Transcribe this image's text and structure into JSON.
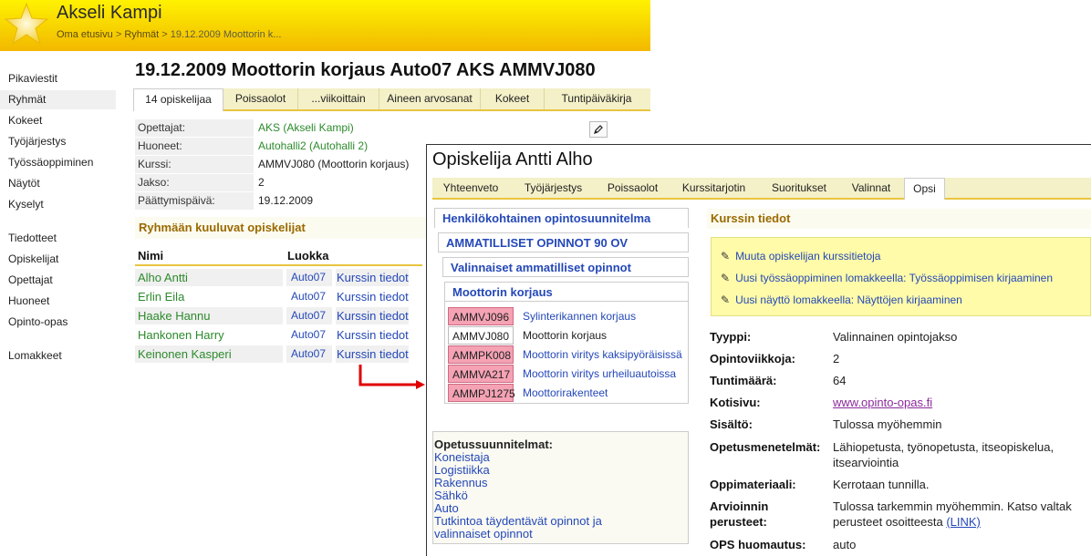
{
  "header": {
    "user_name": "Akseli Kampi",
    "breadcrumb": [
      "Oma etusivu",
      "Ryhmät",
      "19.12.2009 Moottorin k..."
    ],
    "separator": ">"
  },
  "sidebar": {
    "items": [
      {
        "label": "Pikaviestit"
      },
      {
        "label": "Ryhmät",
        "active": true
      },
      {
        "label": "Kokeet"
      },
      {
        "label": "Työjärjestys"
      },
      {
        "label": "Työssäoppiminen"
      },
      {
        "label": "Näytöt"
      },
      {
        "label": "Kyselyt"
      },
      {
        "label": "Tiedotteet"
      },
      {
        "label": "Opiskelijat"
      },
      {
        "label": "Opettajat"
      },
      {
        "label": "Huoneet"
      },
      {
        "label": "Opinto-opas"
      },
      {
        "label": "Lomakkeet"
      }
    ]
  },
  "main": {
    "title": "19.12.2009 Moottorin korjaus Auto07 AKS AMMVJ080",
    "tabs": [
      "14 opiskelijaa",
      "Poissaolot",
      "...viikoittain",
      "Aineen arvosanat",
      "Kokeet",
      "Tuntipäiväkirja"
    ],
    "info": [
      {
        "label": "Opettajat:",
        "value": "AKS (Akseli Kampi)",
        "link": true
      },
      {
        "label": "Huoneet:",
        "value": "Autohalli2 (Autohalli 2)",
        "link": true
      },
      {
        "label": "Kurssi:",
        "value": "AMMVJ080 (Moottorin korjaus)",
        "link": false
      },
      {
        "label": "Jakso:",
        "value": "2",
        "link": false
      },
      {
        "label": "Päättymispäivä:",
        "value": "19.12.2009",
        "link": false
      }
    ],
    "edit_icon": "pencil-icon",
    "students_heading": "Ryhmään kuuluvat opiskelijat",
    "students_columns": [
      "Nimi",
      "Luokka"
    ],
    "students": [
      {
        "name": "Alho Antti",
        "class": "Auto07",
        "link": "Kurssin tiedot"
      },
      {
        "name": "Erlin Eila",
        "class": "Auto07",
        "link": "Kurssin tiedot"
      },
      {
        "name": "Haake Hannu",
        "class": "Auto07",
        "link": "Kurssin tiedot"
      },
      {
        "name": "Hankonen Harry",
        "class": "Auto07",
        "link": "Kurssin tiedot"
      },
      {
        "name": "Keinonen Kasperi",
        "class": "Auto07",
        "link": "Kurssin tiedot"
      }
    ]
  },
  "popup": {
    "title": "Opiskelija Antti Alho",
    "tabs": [
      "Yhteenveto",
      "Työjärjestys",
      "Poissaolot",
      "Kurssitarjotin",
      "Suoritukset",
      "Valinnat",
      "Opsi"
    ],
    "active_tab": "Opsi",
    "plan": {
      "heading": "Henkilökohtainen opintosuunnitelma",
      "section": "AMMATILLISET OPINNOT 90 OV",
      "subsection": "Valinnaiset ammatilliset opinnot",
      "group": "Moottorin korjaus",
      "courses": [
        {
          "code": "AMMVJ096",
          "name": "Sylinterikannen korjaus",
          "highlight": true
        },
        {
          "code": "AMMVJ080",
          "name": "Moottorin korjaus",
          "highlight": false
        },
        {
          "code": "AMMPK008",
          "name": "Moottorin viritys kaksipyöräisissä",
          "highlight": true
        },
        {
          "code": "AMMVA217",
          "name": "Moottorin viritys urheiluautoissa",
          "highlight": true
        },
        {
          "code": "AMMPJ1275",
          "name": "Moottorirakenteet",
          "highlight": true
        }
      ]
    },
    "curricula": {
      "title": "Opetussuunnitelmat:",
      "links": [
        "Koneistaja",
        "Logistiikka",
        "Rakennus",
        "Sähkö",
        "Auto",
        "Tutkintoa täydentävät opinnot ja",
        "valinnaiset opinnot"
      ]
    },
    "course_info": {
      "title": "Kurssin tiedot",
      "actions": [
        "Muuta opiskelijan kurssitietoja",
        "Uusi työssäoppiminen lomakkeella: Työssäoppimisen kirjaaminen",
        "Uusi näyttö lomakkeella: Näyttöjen kirjaaminen"
      ],
      "details": [
        {
          "label": "Tyyppi:",
          "value": "Valinnainen opintojakso"
        },
        {
          "label": "Opintoviikkoja:",
          "value": "2"
        },
        {
          "label": "Tuntimäärä:",
          "value": "64"
        },
        {
          "label": "Kotisivu:",
          "value": "www.opinto-opas.fi"
        },
        {
          "label": "Sisältö:",
          "value": "Tulossa myöhemmin"
        },
        {
          "label": "Opetusmenetelmät:",
          "value": "Lähiopetusta, työnopetusta, itseopiskelua, itsearviointia"
        },
        {
          "label": "Oppimateriaali:",
          "value": "Kerrotaan tunnilla."
        },
        {
          "label": "Arvioinnin",
          "label2": "perusteet:",
          "value": "Tulossa tarkemmin myöhemmin. Katso valtak",
          "value2_prefix": "perusteet osoitteesta ",
          "value2_link": "(LINK)"
        },
        {
          "label": "OPS huomautus:",
          "value": "auto"
        }
      ]
    }
  }
}
